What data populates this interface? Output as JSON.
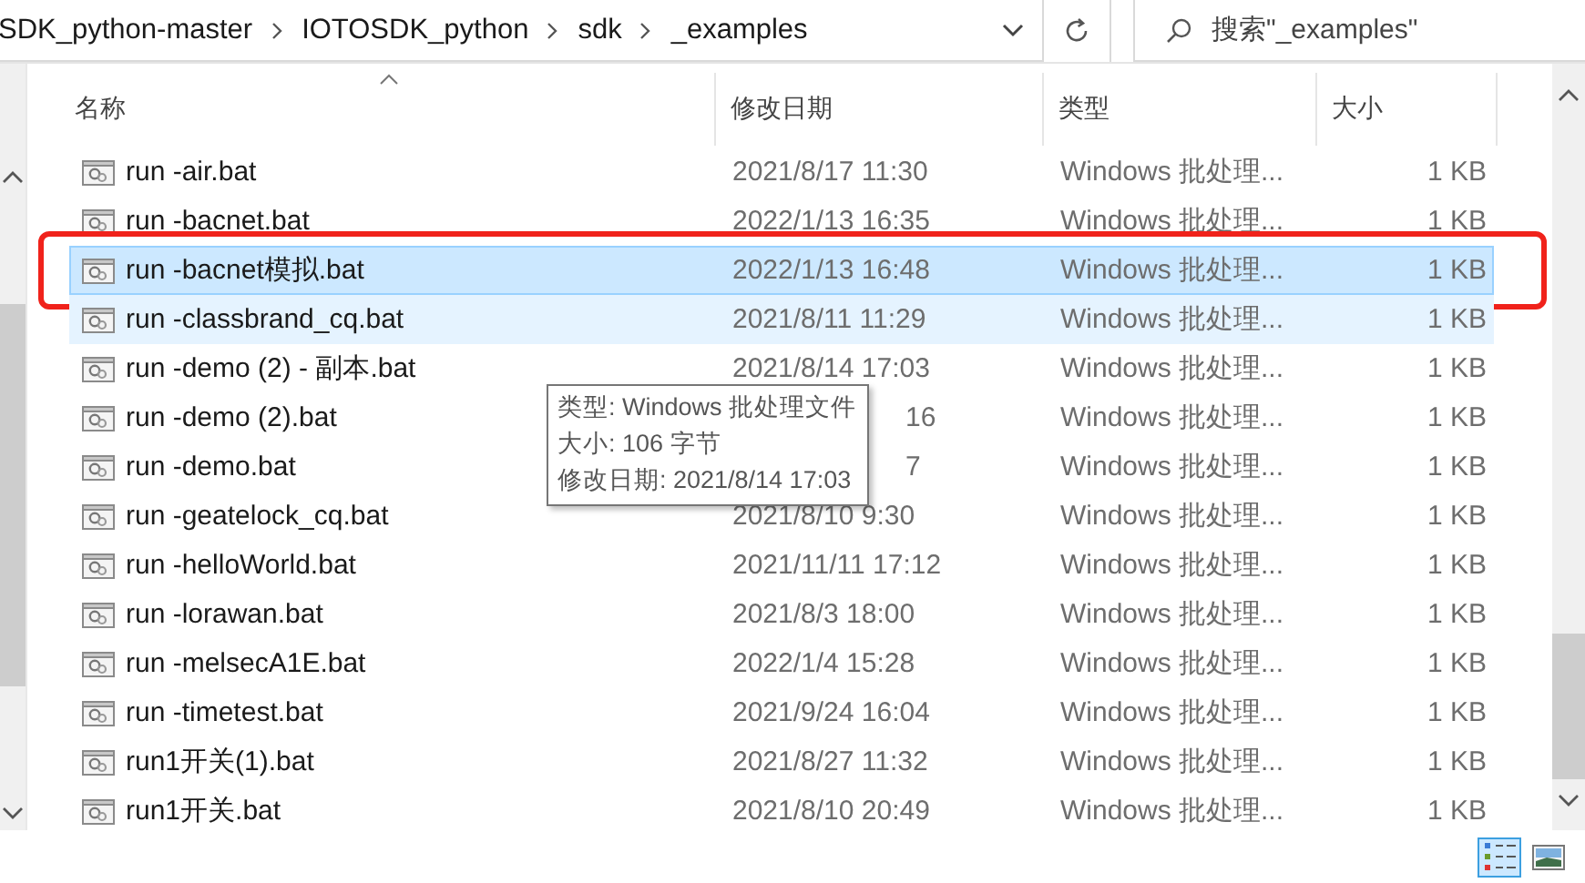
{
  "address_bar": {
    "breadcrumbs": [
      "SDK_python-master",
      "IOTOSDK_python",
      "sdk",
      "_examples"
    ]
  },
  "search": {
    "placeholder": "搜索\"_examples\""
  },
  "columns": [
    {
      "label": "名称",
      "sorted": true
    },
    {
      "label": "修改日期",
      "sorted": false
    },
    {
      "label": "类型",
      "sorted": false
    },
    {
      "label": "大小",
      "sorted": false
    }
  ],
  "rows": [
    {
      "name": "run -air.bat",
      "date": "2021/8/17 11:30",
      "type": "Windows 批处理...",
      "size": "1 KB",
      "selected": false,
      "hovered": false,
      "flagged": false,
      "date_covered": false
    },
    {
      "name": "run -bacnet.bat",
      "date": "2022/1/13 16:35",
      "type": "Windows 批处理...",
      "size": "1 KB",
      "selected": false,
      "hovered": false,
      "flagged": false,
      "date_covered": false
    },
    {
      "name": "run -bacnet模拟.bat",
      "date": "2022/1/13 16:48",
      "type": "Windows 批处理...",
      "size": "1 KB",
      "selected": true,
      "hovered": false,
      "flagged": true,
      "date_covered": false
    },
    {
      "name": "run -classbrand_cq.bat",
      "date": "2021/8/11 11:29",
      "type": "Windows 批处理...",
      "size": "1 KB",
      "selected": false,
      "hovered": true,
      "flagged": false,
      "date_covered": false
    },
    {
      "name": "run -demo (2) - 副本.bat",
      "date": "2021/8/14 17:03",
      "type": "Windows 批处理...",
      "size": "1 KB",
      "selected": false,
      "hovered": false,
      "flagged": false,
      "date_covered": false
    },
    {
      "name": "run -demo (2).bat",
      "date": "16",
      "type": "Windows 批处理...",
      "size": "1 KB",
      "selected": false,
      "hovered": false,
      "flagged": false,
      "date_covered": true
    },
    {
      "name": "run -demo.bat",
      "date": "7",
      "type": "Windows 批处理...",
      "size": "1 KB",
      "selected": false,
      "hovered": false,
      "flagged": false,
      "date_covered": true
    },
    {
      "name": "run -geatelock_cq.bat",
      "date": "2021/8/10 9:30",
      "type": "Windows 批处理...",
      "size": "1 KB",
      "selected": false,
      "hovered": false,
      "flagged": false,
      "date_covered": false
    },
    {
      "name": "run -helloWorld.bat",
      "date": "2021/11/11 17:12",
      "type": "Windows 批处理...",
      "size": "1 KB",
      "selected": false,
      "hovered": false,
      "flagged": false,
      "date_covered": false
    },
    {
      "name": "run -lorawan.bat",
      "date": "2021/8/3 18:00",
      "type": "Windows 批处理...",
      "size": "1 KB",
      "selected": false,
      "hovered": false,
      "flagged": false,
      "date_covered": false
    },
    {
      "name": "run -melsecA1E.bat",
      "date": "2022/1/4 15:28",
      "type": "Windows 批处理...",
      "size": "1 KB",
      "selected": false,
      "hovered": false,
      "flagged": false,
      "date_covered": false
    },
    {
      "name": "run -timetest.bat",
      "date": "2021/9/24 16:04",
      "type": "Windows 批处理...",
      "size": "1 KB",
      "selected": false,
      "hovered": false,
      "flagged": false,
      "date_covered": false
    },
    {
      "name": "run1开关(1).bat",
      "date": "2021/8/27 11:32",
      "type": "Windows 批处理...",
      "size": "1 KB",
      "selected": false,
      "hovered": false,
      "flagged": false,
      "date_covered": false
    },
    {
      "name": "run1开关.bat",
      "date": "2021/8/10 20:49",
      "type": "Windows 批处理...",
      "size": "1 KB",
      "selected": false,
      "hovered": false,
      "flagged": false,
      "date_covered": false
    }
  ],
  "tooltip": {
    "lines": [
      "类型: Windows 批处理文件",
      "大小: 106 字节",
      "修改日期: 2021/8/14 17:03"
    ]
  },
  "view_buttons": [
    {
      "kind": "details",
      "selected": true
    },
    {
      "kind": "tiles",
      "selected": false
    }
  ]
}
